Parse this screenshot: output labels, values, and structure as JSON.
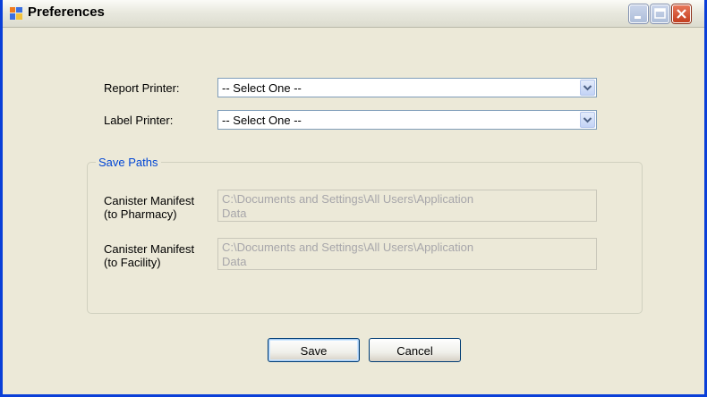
{
  "window": {
    "title": "Preferences",
    "icon": "app-window-icon",
    "controls": [
      "minimize-icon",
      "maximize-icon",
      "close-icon"
    ]
  },
  "form": {
    "report_printer_label": "Report Printer:",
    "report_printer_value": "-- Select One --",
    "label_printer_label": "Label Printer:",
    "label_printer_value": "-- Select One --"
  },
  "save_paths": {
    "title": "Save Paths",
    "rows": [
      {
        "label_line1": "Canister Manifest",
        "label_line2": "(to Pharmacy)",
        "value_line1": "C:\\Documents and Settings\\All Users\\Application",
        "value_line2": "Data"
      },
      {
        "label_line1": "Canister Manifest",
        "label_line2": "(to Facility)",
        "value_line1": "C:\\Documents and Settings\\All Users\\Application",
        "value_line2": "Data"
      }
    ]
  },
  "buttons": {
    "save": "Save",
    "cancel": "Cancel"
  },
  "colors": {
    "window_frame": "#0a3fd8",
    "client_bg": "#ece9d8",
    "group_title": "#0046d5",
    "disabled_text": "#a7a6aa"
  }
}
